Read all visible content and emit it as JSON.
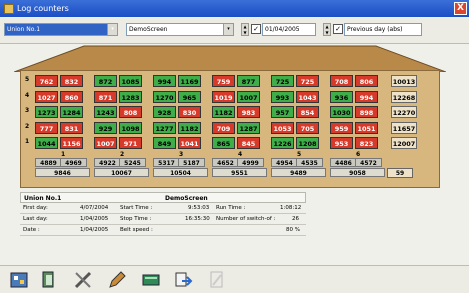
{
  "window": {
    "title": "Log counters",
    "close_glyph": "X"
  },
  "toolbar": {
    "unit_select": "Union No.1",
    "screen_select": "DemoScreen",
    "date_field": "01/04/2005",
    "period_select": "Previous day (abs)",
    "date_checkbox_glyph": "✓",
    "period_checkbox_glyph": "✓",
    "dropdown_glyph": "▾"
  },
  "grid": {
    "rows": [
      {
        "num": "5",
        "cells": [
          "762",
          "832",
          "872",
          "1085",
          "994",
          "1169",
          "759",
          "877",
          "725",
          "725",
          "708",
          "806"
        ],
        "total": "10013"
      },
      {
        "num": "4",
        "cells": [
          "1027",
          "860",
          "871",
          "1283",
          "1270",
          "965",
          "1019",
          "1007",
          "993",
          "1043",
          "936",
          "994"
        ],
        "total": "12268"
      },
      {
        "num": "3",
        "cells": [
          "1273",
          "1284",
          "1243",
          "808",
          "928",
          "830",
          "1182",
          "983",
          "957",
          "854",
          "1030",
          "898"
        ],
        "total": "12270"
      },
      {
        "num": "2",
        "cells": [
          "777",
          "831",
          "929",
          "1098",
          "1277",
          "1182",
          "709",
          "1287",
          "1053",
          "705",
          "959",
          "1051"
        ],
        "total": "11657"
      },
      {
        "num": "1",
        "cells": [
          "1044",
          "1156",
          "1007",
          "971",
          "849",
          "1041",
          "865",
          "845",
          "1226",
          "1208",
          "953",
          "823"
        ],
        "total": "12007"
      }
    ],
    "cell_colors": [
      [
        "red",
        "red",
        "green",
        "green",
        "green",
        "green",
        "red",
        "green",
        "green",
        "red",
        "red",
        "red"
      ],
      [
        "red",
        "red",
        "red",
        "green",
        "green",
        "green",
        "red",
        "green",
        "green",
        "red",
        "green",
        "red"
      ],
      [
        "green",
        "green",
        "green",
        "red",
        "green",
        "red",
        "green",
        "red",
        "green",
        "red",
        "green",
        "red"
      ],
      [
        "red",
        "red",
        "green",
        "green",
        "green",
        "green",
        "red",
        "green",
        "red",
        "red",
        "red",
        "red"
      ],
      [
        "green",
        "red",
        "red",
        "red",
        "green",
        "red",
        "green",
        "red",
        "green",
        "green",
        "red",
        "red"
      ]
    ],
    "group_numbers": [
      "1",
      "2",
      "3",
      "4",
      "5",
      "6"
    ],
    "column_totals": [
      "4889",
      "4969",
      "4922",
      "5245",
      "5317",
      "5187",
      "4652",
      "4999",
      "4954",
      "4535",
      "4486",
      "4572"
    ],
    "group_totals": [
      "9846",
      "10067",
      "10504",
      "9551",
      "9489",
      "9058"
    ],
    "grand_total": "59"
  },
  "info": {
    "title_left": "Union No.1",
    "title_right": "DemoScreen",
    "first_day_label": "First day:",
    "first_day_value": "4/07/2004",
    "start_time_label": "Start Time :",
    "start_time_value": "9:53:03",
    "run_time_label": "Run Time :",
    "run_time_value": "1:08:12",
    "last_day_label": "Last day:",
    "last_day_value": "1/04/2005",
    "stop_time_label": "Stop Time :",
    "stop_time_value": "16:35:30",
    "switch_off_label": "Number of switch-of :",
    "switch_off_value": "26",
    "date_label": "Date :",
    "date_value": "1/04/2005",
    "belt_speed_label": "Belt speed :",
    "belt_speed_value": "80 %"
  },
  "bottom_toolbar": {
    "icons": [
      "settings-icon",
      "printer-icon",
      "tools-icon",
      "edit-icon",
      "database-icon",
      "export-icon",
      "disabled-icon"
    ]
  }
}
